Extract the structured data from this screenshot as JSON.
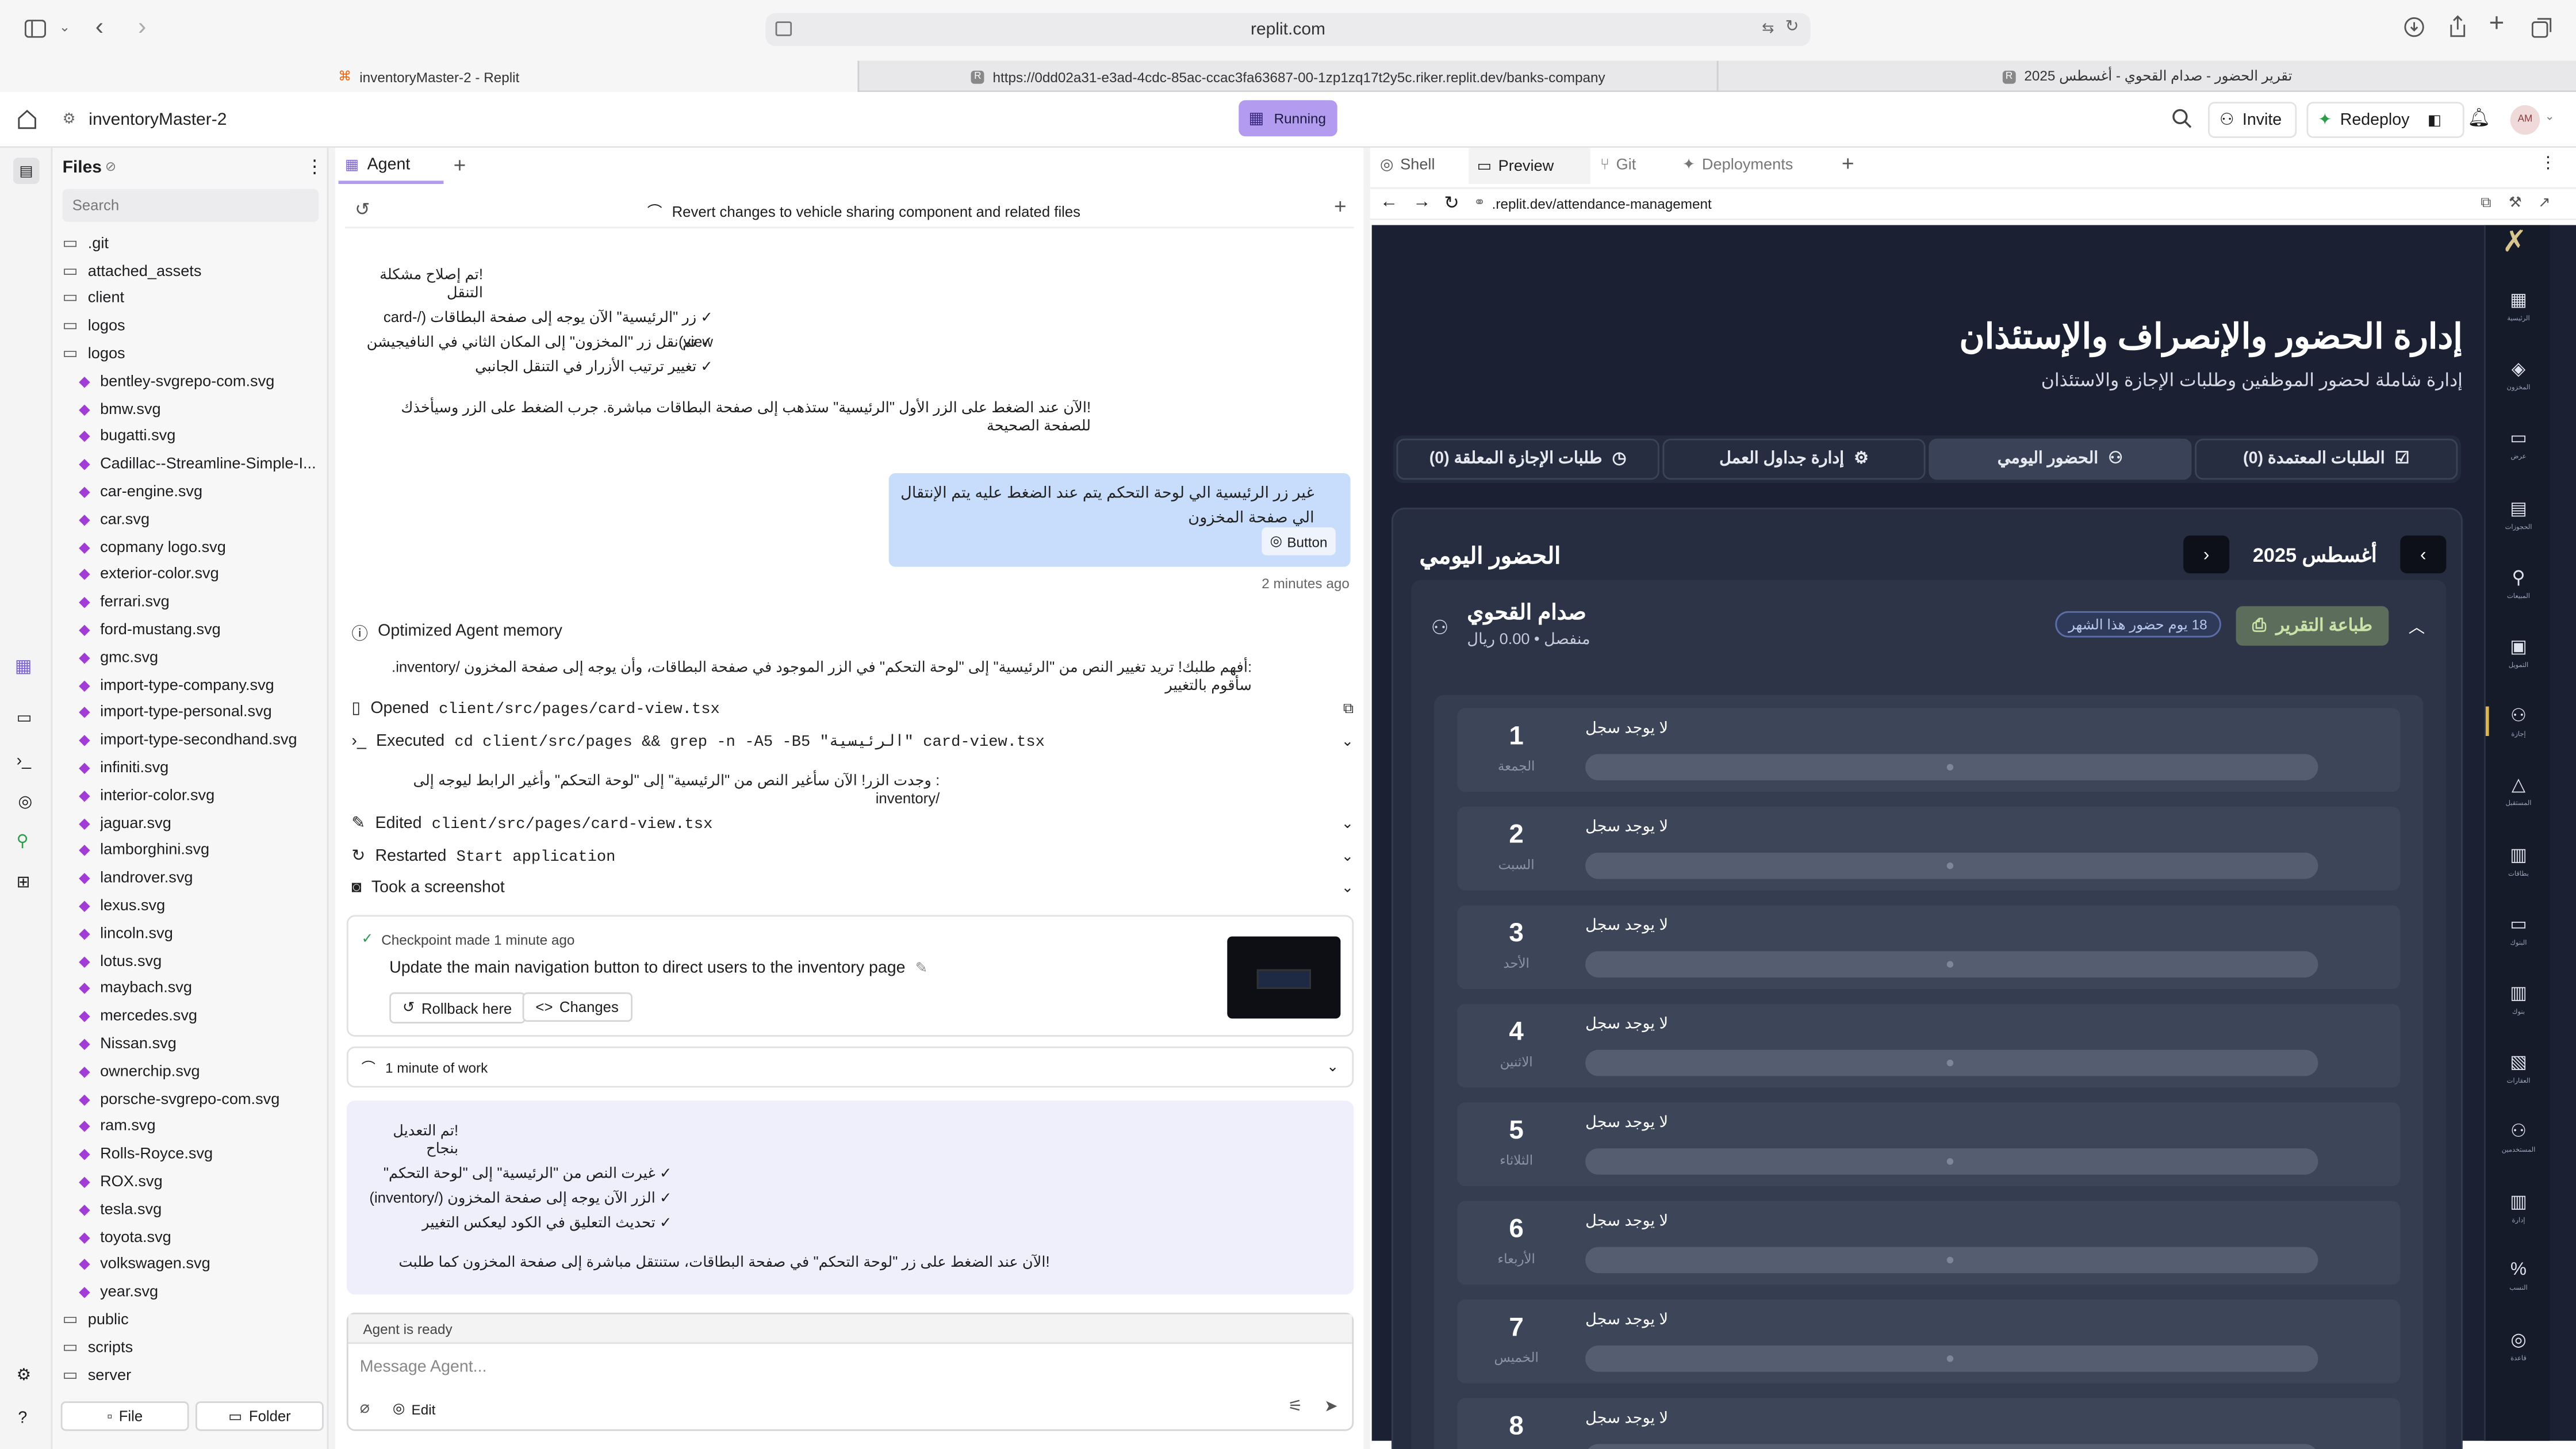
{
  "browser": {
    "address": "replit.com",
    "tabs": [
      {
        "label": "inventoryMaster-2 - Replit"
      },
      {
        "label": "https://0dd02a31-e3ad-4cdc-85ac-ccac3fa63687-00-1zp1zq17t2y5c.riker.replit.dev/banks-company"
      },
      {
        "label": "تقرير الحضور - صدام القحوي - أغسطس 2025"
      }
    ]
  },
  "header": {
    "project": "inventoryMaster-2",
    "status": "Running",
    "invite": "Invite",
    "redeploy": "Redeploy",
    "avatar": "AM"
  },
  "files": {
    "title": "Files",
    "search_placeholder": "Search",
    "items": [
      ".git",
      "attached_assets",
      "client",
      "logos",
      "logos",
      "bentley-svgrepo-com.svg",
      "bmw.svg",
      "bugatti.svg",
      "Cadillac--Streamline-Simple-I...",
      "car-engine.svg",
      "car.svg",
      "copmany logo.svg",
      "exterior-color.svg",
      "ferrari.svg",
      "ford-mustang.svg",
      "gmc.svg",
      "import-type-company.svg",
      "import-type-personal.svg",
      "import-type-secondhand.svg",
      "infiniti.svg",
      "interior-color.svg",
      "jaguar.svg",
      "lamborghini.svg",
      "landrover.svg",
      "lexus.svg",
      "lincoln.svg",
      "lotus.svg",
      "maybach.svg",
      "mercedes.svg",
      "Nissan.svg",
      "ownerchip.svg",
      "porsche-svgrepo-com.svg",
      "ram.svg",
      "Rolls-Royce.svg",
      "ROX.svg",
      "tesla.svg",
      "toyota.svg",
      "volkswagen.svg",
      "year.svg",
      "public",
      "scripts",
      "server"
    ],
    "file_btn": "File",
    "folder_btn": "Folder"
  },
  "agent": {
    "tab": "Agent",
    "revert": "Revert changes to vehicle sharing component and related files",
    "msg1": {
      "title": "!تم إصلاح مشكلة التنقل",
      "lines": [
        "✓ زر \"الرئيسية\" الآن يوجه إلى صفحة البطاقات (/card-view)",
        "✓ تم نقل زر \"المخزون\" إلى المكان الثاني في النافيجيشن",
        "✓ تغيير ترتيب الأزرار في التنقل الجانبي"
      ],
      "footer": "!الآن عند الضغط على الزر الأول \"الرئيسية\" ستذهب إلى صفحة البطاقات مباشرة. جرب الضغط على الزر وسيأخذك للصفحة الصحيحة"
    },
    "user": {
      "text": "غير زر الرئيسية الي لوحة التحكم يتم عند الضغط عليه يتم الإنتقال الي صفحة المخزون",
      "chip": "Button",
      "time": "2 minutes ago"
    },
    "memory": "Optimized Agent memory",
    "understand": ":أفهم طلبك! تريد تغيير النص من \"الرئيسية\" إلى \"لوحة التحكم\" في الزر الموجود في صفحة البطاقات، وأن يوجه إلى صفحة المخزون /inventory. سأقوم بالتغيير",
    "opened": "Opened",
    "opened_file": "client/src/pages/card-view.tsx",
    "executed": "Executed",
    "exec_cmd": "cd client/src/pages && grep -n -A5 -B5 \"الرئيسية\" card-view.tsx",
    "found": ": وجدت الزر! الآن سأغير النص من \"الرئيسية\" إلى \"لوحة التحكم\" وأغير الرابط ليوجه إلى /inventory",
    "edited": "Edited",
    "edited_file": "client/src/pages/card-view.tsx",
    "restarted": "Restarted",
    "restarted_app": "Start application",
    "screenshot": "Took a screenshot",
    "checkpoint": {
      "label": "Checkpoint made 1 minute ago",
      "title": "Update the main navigation button to direct users to the inventory page",
      "rollback": "Rollback here",
      "changes": "Changes"
    },
    "work": "1 minute of work",
    "msg2": {
      "title": "!تم التعديل بنجاح",
      "lines": [
        "✓ غيرت النص من \"الرئيسية\" إلى \"لوحة التحكم\"",
        "✓ الزر الآن يوجه إلى صفحة المخزون (/inventory)",
        "✓ تحديث التعليق في الكود ليعكس التغيير"
      ],
      "footer": "!الآن عند الضغط على زر \"لوحة التحكم\" في صفحة البطاقات، ستنتقل مباشرة إلى صفحة المخزون كما طلبت"
    },
    "ready": "Agent is ready",
    "input_placeholder": "Message Agent...",
    "edit": "Edit"
  },
  "preview": {
    "tabs": {
      "shell": "Shell",
      "preview": "Preview",
      "git": "Git",
      "deployments": "Deployments"
    },
    "url": ".replit.dev/attendance-management"
  },
  "app": {
    "title": "إدارة الحضور والإنصراف والإستئذان",
    "subtitle": "إدارة شاملة لحضور الموظفين وطلبات الإجازة والاستئذان",
    "tabs": [
      "الطلبات المعتمدة (0)",
      "الحضور اليومي",
      "إدارة جداول العمل",
      "طلبات الإجازة المعلقة (0)"
    ],
    "section": "الحضور اليومي",
    "month": "أغسطس 2025",
    "employee": {
      "name": "صدام القحوي",
      "meta": "منفصل • 0.00 ريال",
      "badge": "18 يوم حضور هذا الشهر",
      "print": "طباعة التقرير"
    },
    "no_record": "لا يوجد سجل",
    "days": [
      {
        "num": "1",
        "name": "الجمعة"
      },
      {
        "num": "2",
        "name": "السبت"
      },
      {
        "num": "3",
        "name": "الأحد"
      },
      {
        "num": "4",
        "name": "الاثنين"
      },
      {
        "num": "5",
        "name": "الثلاثاء"
      },
      {
        "num": "6",
        "name": "الأربعاء"
      },
      {
        "num": "7",
        "name": "الخميس"
      },
      {
        "num": "8",
        "name": ""
      }
    ],
    "sidebar": [
      "الرئيسية",
      "المخزون",
      "عرض",
      "الحجوزات",
      "المبيعات",
      "التمويل",
      "إجازة",
      "المستقبل",
      "بطاقات",
      "البنوك",
      "بنوك",
      "العقارات",
      "المستخدمين",
      "إدارة",
      "النسب",
      "قاعدة"
    ]
  },
  "colors": {
    "accent": "#b39cf0",
    "app_bg": "#1b2133",
    "user_bubble": "#c8ddfb",
    "print_btn": "#5d6d5b"
  }
}
